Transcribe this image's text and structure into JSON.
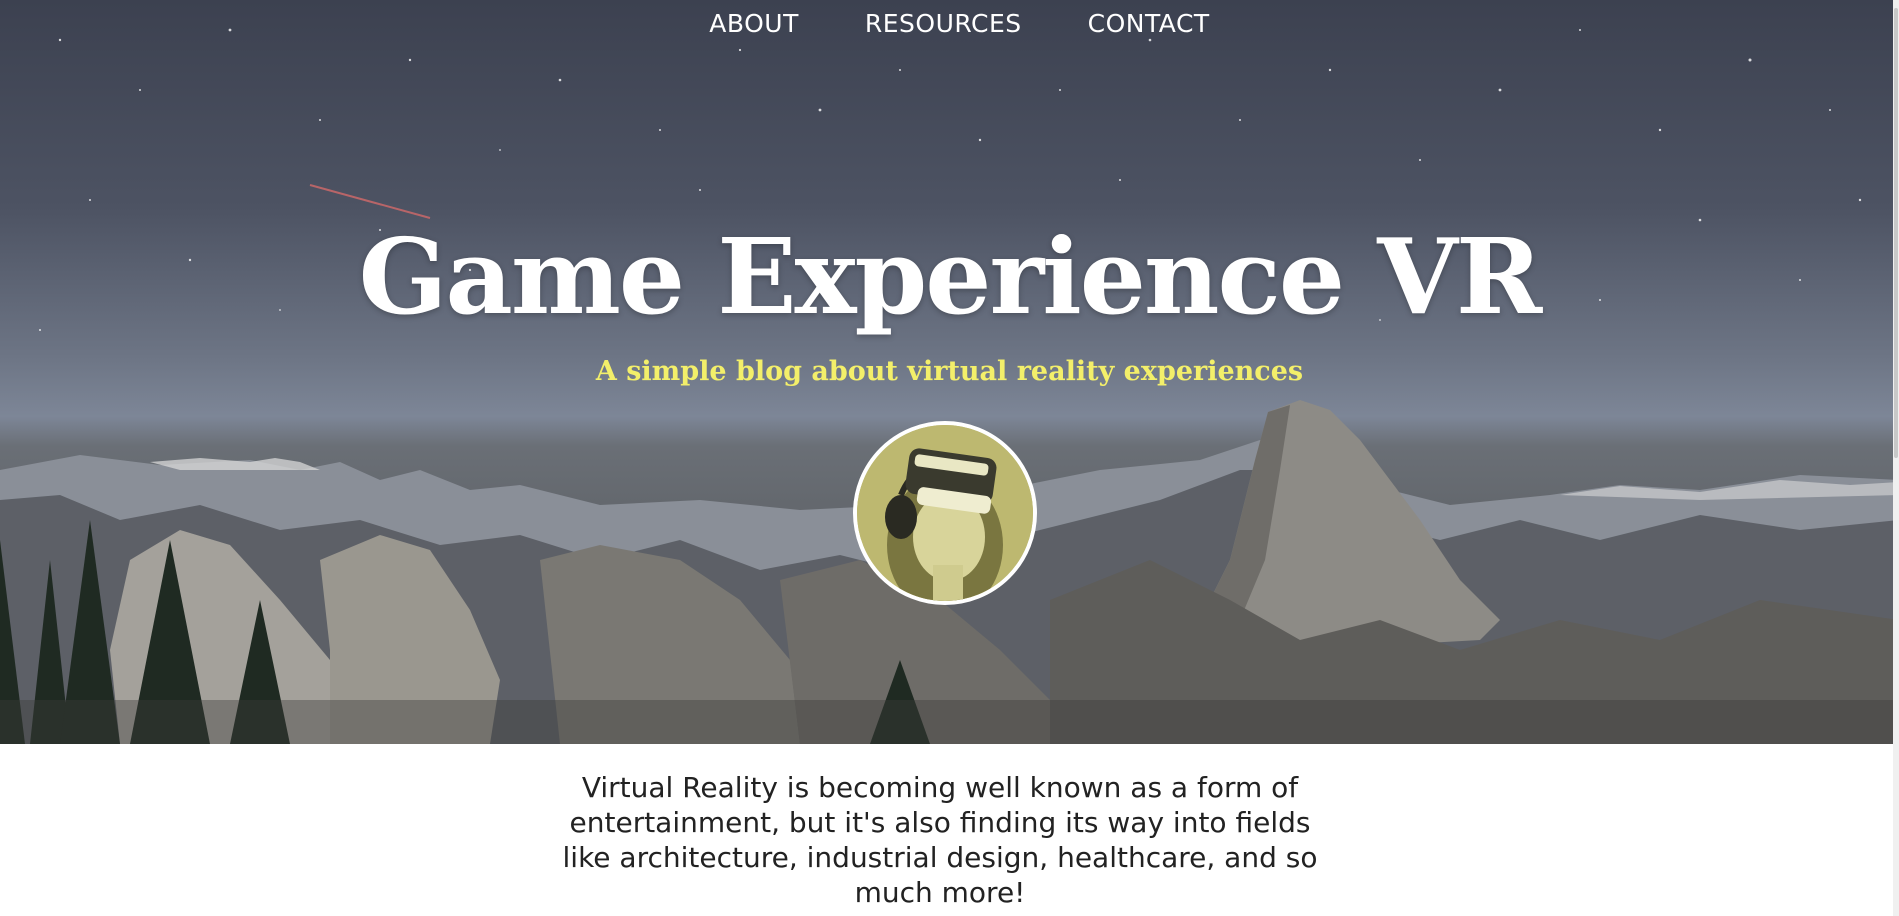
{
  "nav": {
    "items": [
      {
        "label": "ABOUT"
      },
      {
        "label": "RESOURCES"
      },
      {
        "label": "CONTACT"
      }
    ]
  },
  "hero": {
    "title": "Game Experience VR",
    "subtitle": "A simple blog about virtual reality experiences",
    "subtitle_color": "#f3ef6a",
    "avatar_icon": "vr-headset-user-avatar",
    "background": "starry-night-mountain-valley-photo"
  },
  "intro": {
    "text": "Virtual Reality is becoming well known as a form of entertainment, but it's also finding its way into fields like architecture, industrial design, healthcare, and so much more!"
  }
}
